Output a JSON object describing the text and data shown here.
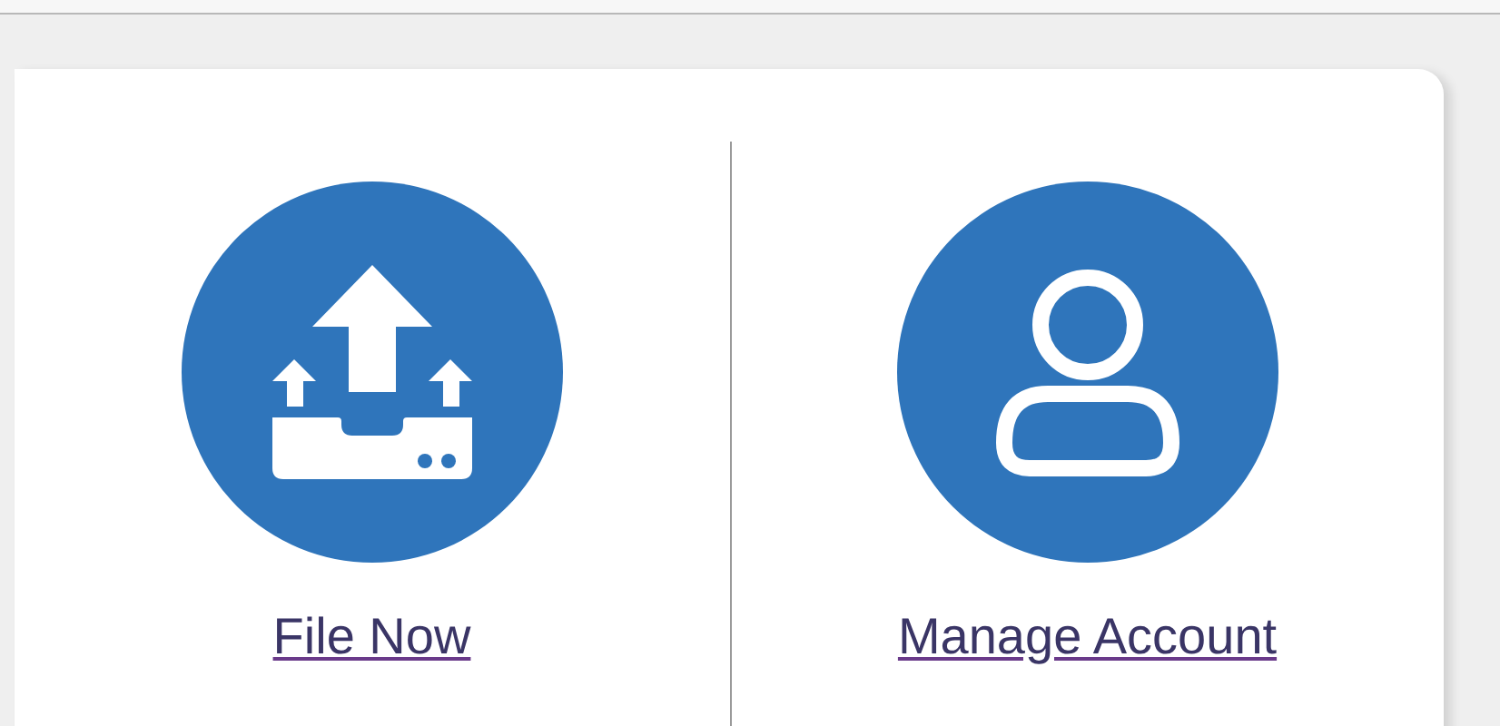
{
  "actions": [
    {
      "kind": "upload",
      "label": "File Now"
    },
    {
      "kind": "account",
      "label": "Manage Account"
    }
  ]
}
